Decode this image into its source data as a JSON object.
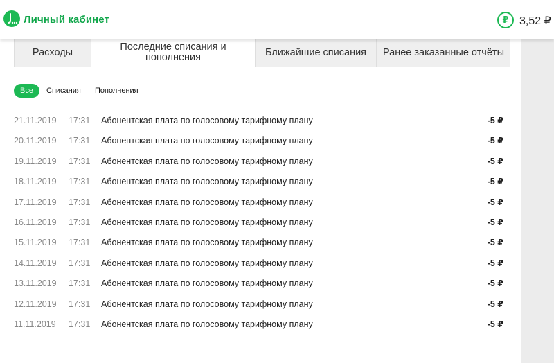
{
  "header": {
    "brand": "Личный кабинет",
    "balance": "3,52 ₽",
    "currency_symbol": "₽",
    "accent_color": "#1db954"
  },
  "tabs": [
    {
      "label": "Расходы",
      "active": false
    },
    {
      "label": "Последние списания и пополнения",
      "active": true
    },
    {
      "label": "Ближайшие списания",
      "active": false
    },
    {
      "label": "Ранее заказанные отчёты",
      "active": false
    }
  ],
  "filters": [
    {
      "label": "Все",
      "active": true
    },
    {
      "label": "Списания",
      "active": false
    },
    {
      "label": "Пополнения",
      "active": false
    }
  ],
  "transactions": [
    {
      "date": "21.11.2019",
      "time": "17:31",
      "description": "Абонентская плата по голосовому тарифному плану",
      "amount": "-5 ₽"
    },
    {
      "date": "20.11.2019",
      "time": "17:31",
      "description": "Абонентская плата по голосовому тарифному плану",
      "amount": "-5 ₽"
    },
    {
      "date": "19.11.2019",
      "time": "17:31",
      "description": "Абонентская плата по голосовому тарифному плану",
      "amount": "-5 ₽"
    },
    {
      "date": "18.11.2019",
      "time": "17:31",
      "description": "Абонентская плата по голосовому тарифному плану",
      "amount": "-5 ₽"
    },
    {
      "date": "17.11.2019",
      "time": "17:31",
      "description": "Абонентская плата по голосовому тарифному плану",
      "amount": "-5 ₽"
    },
    {
      "date": "16.11.2019",
      "time": "17:31",
      "description": "Абонентская плата по голосовому тарифному плану",
      "amount": "-5 ₽"
    },
    {
      "date": "15.11.2019",
      "time": "17:31",
      "description": "Абонентская плата по голосовому тарифному плану",
      "amount": "-5 ₽"
    },
    {
      "date": "14.11.2019",
      "time": "17:31",
      "description": "Абонентская плата по голосовому тарифному плану",
      "amount": "-5 ₽"
    },
    {
      "date": "13.11.2019",
      "time": "17:31",
      "description": "Абонентская плата по голосовому тарифному плану",
      "amount": "-5 ₽"
    },
    {
      "date": "12.11.2019",
      "time": "17:31",
      "description": "Абонентская плата по голосовому тарифному плану",
      "amount": "-5 ₽"
    },
    {
      "date": "11.11.2019",
      "time": "17:31",
      "description": "Абонентская плата по голосовому тарифному плану",
      "amount": "-5 ₽"
    }
  ]
}
